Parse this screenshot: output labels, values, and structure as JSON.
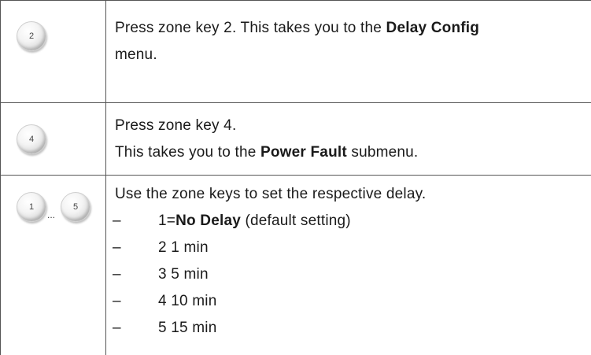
{
  "rows": [
    {
      "keys": [
        "2"
      ],
      "line1_prefix": "Press zone key 2. This takes you to the ",
      "line1_bold": "Delay Config",
      "line2": "menu."
    },
    {
      "keys": [
        "4"
      ],
      "line1": "Press zone key 4.",
      "line2_prefix": "This takes you to the ",
      "line2_bold": "Power Fault",
      "line2_suffix": " submenu."
    },
    {
      "keys": [
        "1",
        "5"
      ],
      "key_separator": "...",
      "intro": "Use the zone keys to set the respective delay.",
      "bullet": "–",
      "items": [
        {
          "prefix": "1=",
          "bold": "No Delay",
          "suffix": " (default setting)"
        },
        {
          "text": "2 1 min"
        },
        {
          "text": "3 5 min"
        },
        {
          "text": "4 10 min"
        },
        {
          "text": "5 15 min"
        }
      ]
    }
  ]
}
